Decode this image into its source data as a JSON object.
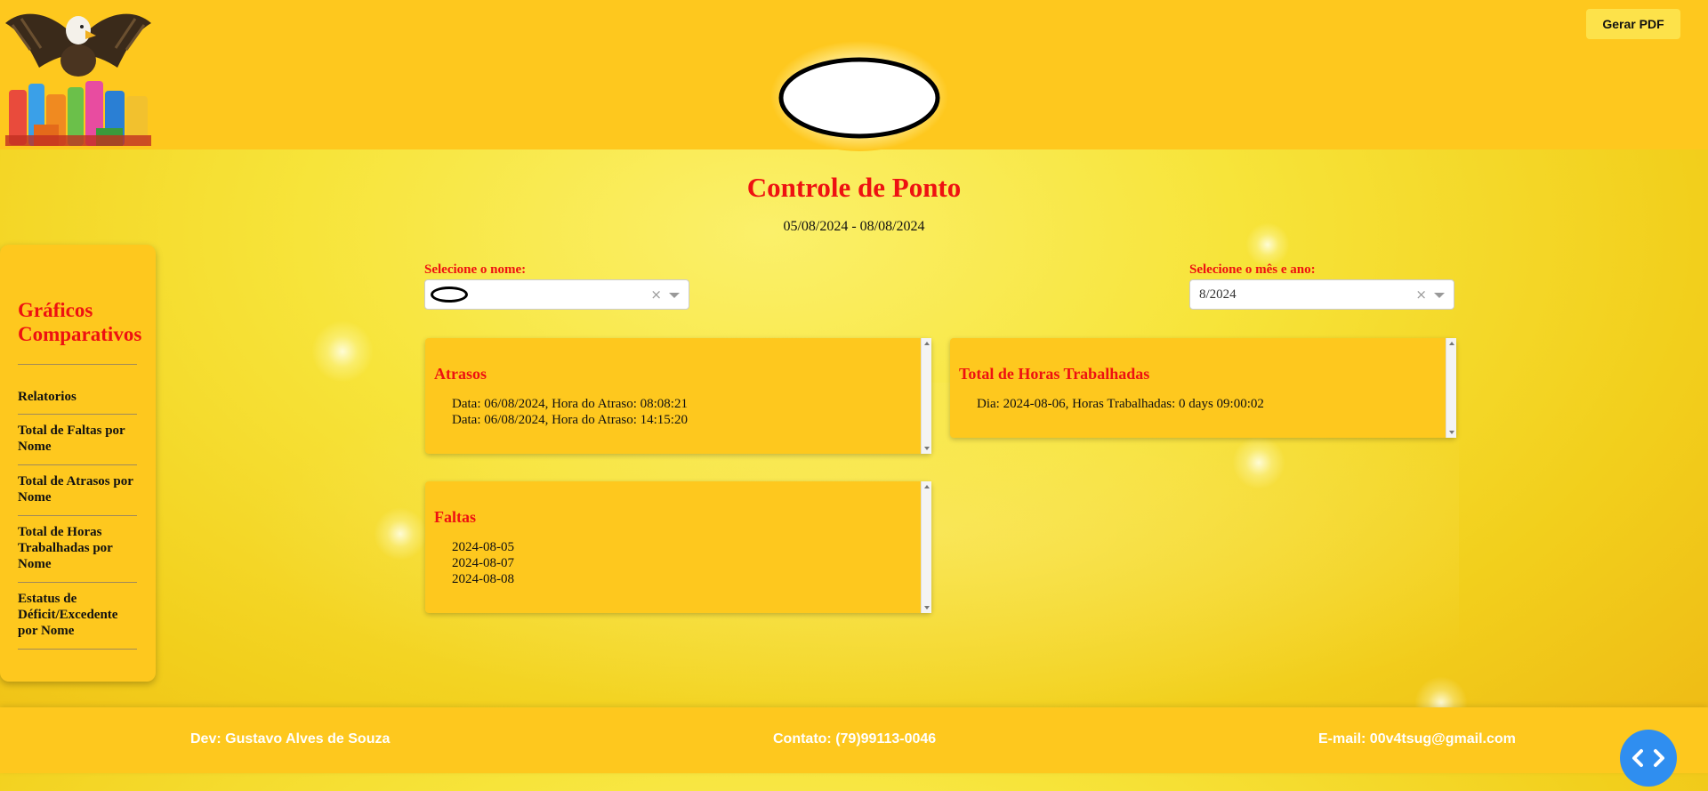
{
  "header": {
    "pdf_button_label": "Gerar PDF",
    "logo_icon": "eagle-cleaning-products-logo",
    "center_logo_icon": "redacted-oval-logo"
  },
  "main": {
    "title": "Controle de Ponto",
    "date_range": "05/08/2024 - 08/08/2024"
  },
  "sidebar": {
    "title": "Gráficos Comparativos",
    "items": [
      {
        "label": "Relatorios"
      },
      {
        "label": "Total de Faltas por Nome"
      },
      {
        "label": "Total de Atrasos por Nome"
      },
      {
        "label": "Total de Horas Trabalhadas por Nome"
      },
      {
        "label": "Estatus de Déficit/Excedente por Nome"
      }
    ]
  },
  "filters": {
    "name_label": "Selecione o nome:",
    "name_value": "",
    "month_label": "Selecione o mês e ano:",
    "month_value": "8/2024",
    "clear_symbol": "×"
  },
  "panels": {
    "atrasos": {
      "title": "Atrasos",
      "lines": [
        "Data: 06/08/2024, Hora do Atraso: 08:08:21",
        "Data: 06/08/2024, Hora do Atraso: 14:15:20"
      ]
    },
    "horas": {
      "title": "Total de Horas Trabalhadas",
      "lines": [
        "Dia: 2024-08-06, Horas Trabalhadas: 0 days 09:00:02"
      ]
    },
    "faltas": {
      "title": "Faltas",
      "lines": [
        "2024-08-05",
        "2024-08-07",
        "2024-08-08"
      ]
    }
  },
  "footer": {
    "dev": "Dev: Gustavo Alves de Souza",
    "contact": "Contato: (79)99113-0046",
    "email": "E-mail: 00v4tsug@gmail.com"
  },
  "fab_icon": "code-brackets-icon",
  "colors": {
    "primary_yellow": "#fec81e",
    "title_red": "#ee1111",
    "fab_blue": "#2f8ef0"
  }
}
